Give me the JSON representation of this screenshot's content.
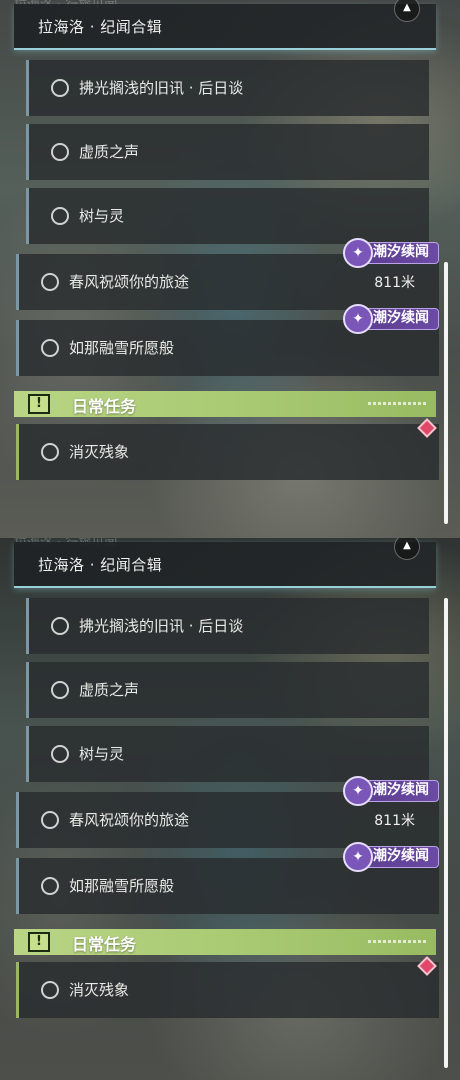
{
  "quest_header": {
    "title": "拉海洛 · 纪闻合辑",
    "cut_text": "拉海洛 · 行旅见闻"
  },
  "sub_quests": [
    {
      "label": "拂光搁浅的旧讯 · 后日谈"
    },
    {
      "label": "虚质之声"
    },
    {
      "label": "树与灵"
    }
  ],
  "main_quests": [
    {
      "label": "春风祝颂你的旅途",
      "badge": "潮汐续闻",
      "distance": "811米"
    },
    {
      "label": "如那融雪所愿般",
      "badge": "潮汐续闻"
    }
  ],
  "daily_section": {
    "title": "日常任务",
    "icon": "!",
    "items": [
      {
        "label": "消灭残象"
      }
    ]
  },
  "colors": {
    "accent_line": "#9ad0d8",
    "daily_green": "#a7c870",
    "badge_purple": "#6b4aa3",
    "diamond_red": "#e0486a"
  }
}
